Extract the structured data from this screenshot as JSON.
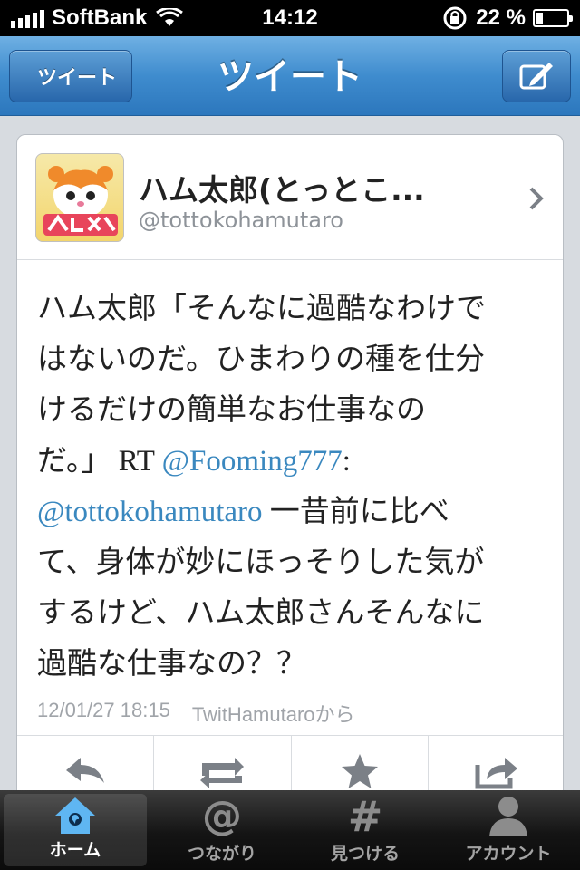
{
  "status_bar": {
    "carrier": "SoftBank",
    "time": "14:12",
    "battery_percent_text": "22 %",
    "battery_level": 0.22
  },
  "nav": {
    "back_label": "ツイート",
    "title": "ツイート",
    "compose_icon": "compose-icon"
  },
  "tweet": {
    "display_name": "ハム太郎(とっとこ...",
    "screen_name": "@tottokohamutaro",
    "lines": [
      {
        "text": "ハム太郎「そんなに過酷なわけで"
      },
      {
        "text": "はないのだ。ひまわりの種を仕分"
      },
      {
        "text": "けるだけの簡単なお仕事なの"
      },
      {
        "pre": "だ。」 RT ",
        "link": "@Fooming777",
        "post": ":"
      },
      {
        "link": "@tottokohamutaro",
        "post": " 一昔前に比べ"
      },
      {
        "text": "て、身体が妙にほっそりした気が"
      },
      {
        "text": "するけど、ハム太郎さんそんなに"
      },
      {
        "text": "過酷な仕事なの？？"
      }
    ],
    "timestamp": "12/01/27 18:15",
    "source": "TwitHamutaroから",
    "actions": [
      "reply-icon",
      "retweet-icon",
      "favorite-icon",
      "share-icon"
    ]
  },
  "tab_bar": {
    "tabs": [
      {
        "label": "ホーム",
        "icon": "home-icon",
        "active": true
      },
      {
        "label": "つながり",
        "icon": "at-icon",
        "active": false
      },
      {
        "label": "見つける",
        "icon": "hashtag-icon",
        "active": false
      },
      {
        "label": "アカウント",
        "icon": "person-icon",
        "active": false
      }
    ]
  },
  "colors": {
    "nav_blue": "#3f8cce",
    "link": "#3a88bf",
    "meta_gray": "#a0a4a9"
  }
}
